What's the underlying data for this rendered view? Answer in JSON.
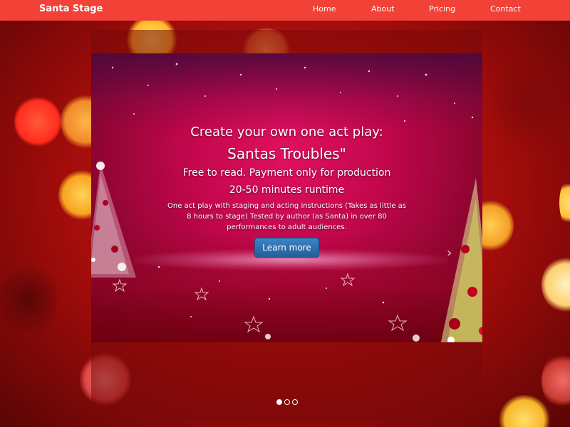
{
  "navbar": {
    "brand": "Santa Stage",
    "links": [
      "Home",
      "About",
      "Pricing",
      "Contact"
    ]
  },
  "carousel": {
    "slide": {
      "headline1": "Create your own one act play:",
      "headline2": "Santas Troubles\"",
      "line3": "Free to read. Payment only for production",
      "line4": "20-50 minutes runtime",
      "description": "One act play with staging and acting instructions (Takes as little as 8 hours to stage) Tested by author (as Santa) in over 80 performances to adult audiences.",
      "button_label": "Learn more"
    },
    "indicators": {
      "count": 3,
      "active_index": 0
    },
    "next_icon": "›"
  },
  "colors": {
    "navbar_bg": "#f24137",
    "button_bg": "#2d6fae",
    "slide_magenta": "#c3074d"
  }
}
